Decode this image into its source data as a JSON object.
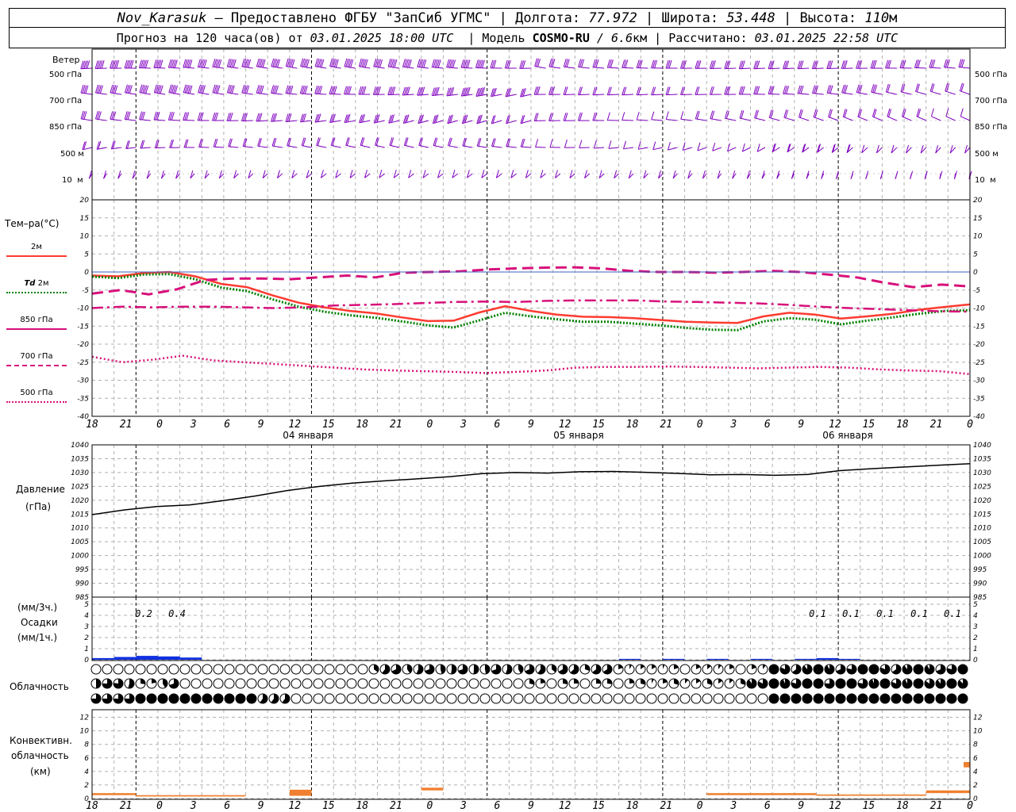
{
  "header": {
    "station": "Nov_Karasuk",
    "provider": "– Предоставлено ФГБУ \"ЗапСиб УГМС\" |",
    "lon_label": "Долгота:",
    "lon_value": "77.972",
    "lat_label": "| Широта:",
    "lat_value": "53.448",
    "alt_label": "| Высота:",
    "alt_value": "110",
    "alt_unit": "м"
  },
  "subheader": {
    "forecast_label": "Прогноз на 120 часа(ов) от",
    "forecast_time": "03.01.2025 18:00 UTC",
    "model_label": "| Модель",
    "model_name": "COSMO-RU",
    "model_res": "/ 6.6",
    "model_res_unit": "км",
    "calc_label": "| Рассчитано:",
    "calc_time": "03.01.2025 22:58 UTC"
  },
  "labels": {
    "wind": "Ветер",
    "wind_levels": [
      "500 гПа",
      "700 гПа",
      "850 гПа",
      "500 м",
      "10  м"
    ],
    "temp": "Тем–ра(°C)",
    "pressure": "Давление",
    "pressure_unit": "(гПа)",
    "precip_3h": "(мм/3ч.)",
    "precip": "Осадки",
    "precip_1h": "(мм/1ч.)",
    "cloud": "Облачность",
    "conv1": "Конвективн.",
    "conv2": "облачность",
    "conv3": "(км)"
  },
  "legend": {
    "t2m": {
      "label": "2м",
      "color": "#ff3b30"
    },
    "td2m": {
      "label_prefix": "Td",
      "label": "2м",
      "color": "#008000"
    },
    "t850": {
      "label": "850 гПа",
      "color": "#d8107a"
    },
    "t700": {
      "label": "700 гПа",
      "color": "#d8107a"
    },
    "t500": {
      "label": "500 гПа",
      "color": "#d8107a"
    }
  },
  "chart_data": [
    {
      "type": "wind_barbs",
      "levels": [
        "500 гПа",
        "700 гПа",
        "850 гПа",
        "500 м",
        "10  м"
      ],
      "color": "#8000c0"
    },
    {
      "type": "line",
      "title": "Тем–ра(°C)",
      "x_ticks": [
        "18",
        "21",
        "0",
        "3",
        "6",
        "9",
        "12",
        "15",
        "18",
        "21",
        "0",
        "3",
        "6",
        "9",
        "12",
        "15",
        "18",
        "21",
        "0",
        "3",
        "6",
        "9",
        "12",
        "15",
        "18",
        "21",
        "0"
      ],
      "day_labels": [
        "04 января",
        "05 января",
        "06 января"
      ],
      "ylim": [
        -40,
        20
      ],
      "y_ticks": [
        20,
        15,
        10,
        5,
        0,
        -5,
        -10,
        -15,
        -20,
        -25,
        -30,
        -35,
        -40
      ],
      "hours": [
        0,
        3,
        6,
        9,
        12,
        15,
        18,
        21,
        24,
        27,
        30,
        33,
        36,
        39,
        42,
        45,
        48,
        51,
        54,
        57,
        60,
        63,
        66,
        69,
        72,
        75,
        78,
        81,
        84,
        87,
        90,
        93,
        96,
        99,
        102,
        105,
        108,
        111,
        114,
        117,
        120
      ],
      "series": [
        {
          "name": "2м",
          "color": "#ff3b30",
          "values": [
            -1,
            -1.2,
            -0.3,
            0,
            -1.2,
            -3.3,
            -4.2,
            -6.5,
            -8.5,
            -9.8,
            -10.8,
            -11.5,
            -12.6,
            -13.6,
            -13.5,
            -11.2,
            -9.5,
            -10.8,
            -11.8,
            -12.4,
            -12.5,
            -12.8,
            -13.3,
            -13.8,
            -14,
            -14.1,
            -12.3,
            -11.3,
            -11.8,
            -12.9,
            -12.3,
            -11.6,
            -10.5,
            -9.7,
            -9
          ]
        },
        {
          "name": "Td 2м",
          "color": "#008000",
          "values": [
            -1.3,
            -1.7,
            -0.7,
            -0.6,
            -2,
            -4.3,
            -5.3,
            -7.6,
            -9.6,
            -11,
            -12,
            -12.7,
            -13.7,
            -14.8,
            -15.4,
            -13.4,
            -11.3,
            -12.3,
            -13.1,
            -13.8,
            -13.8,
            -14.3,
            -14.8,
            -15.5,
            -16,
            -16.1,
            -13.7,
            -12.8,
            -13.2,
            -14.5,
            -13.5,
            -12.6,
            -11.6,
            -10.8,
            -10.6
          ]
        },
        {
          "name": "850 гПа",
          "color": "#d8107a",
          "values": [
            -6,
            -5,
            -6.2,
            -4.8,
            -2.2,
            -1.8,
            -1.8,
            -2,
            -1.5,
            -1,
            -1.5,
            -0.2,
            0,
            0.2,
            0.7,
            1,
            1.2,
            1.3,
            1,
            0.3,
            0,
            0,
            -0.2,
            0,
            0.3,
            0,
            -0.7,
            -1.5,
            -3,
            -4.2,
            -3.5,
            -4
          ]
        },
        {
          "name": "700 гПа",
          "color": "#d8107a",
          "values": [
            -10,
            -9.6,
            -9.8,
            -9.6,
            -9.6,
            -9.8,
            -10,
            -9.8,
            -9.3,
            -9.1,
            -8.9,
            -8.6,
            -8.3,
            -8.2,
            -8.3,
            -8,
            -7.9,
            -7.9,
            -7.9,
            -8.2,
            -8.3,
            -8.5,
            -8.7,
            -9.1,
            -9.6,
            -10,
            -10.3,
            -10.6,
            -10.9,
            -11
          ]
        },
        {
          "name": "500 гПа",
          "color": "#d8107a",
          "values": [
            -23.5,
            -25,
            -24.3,
            -23.2,
            -24.5,
            -25,
            -25.5,
            -26,
            -26.5,
            -27,
            -27.3,
            -27.5,
            -27.7,
            -28,
            -27.7,
            -27.3,
            -26.5,
            -26.3,
            -26.3,
            -26.2,
            -26.3,
            -26.5,
            -26.7,
            -26.5,
            -26.3,
            -26.5,
            -27,
            -27.3,
            -27.5,
            -28.3
          ]
        }
      ]
    },
    {
      "type": "line",
      "title": "Давление (гПа)",
      "ylim": [
        985,
        1040
      ],
      "y_ticks": [
        1040,
        1035,
        1030,
        1025,
        1020,
        1015,
        1010,
        1005,
        1000,
        995,
        990,
        985
      ],
      "series": [
        {
          "name": "Давление",
          "color": "#000000",
          "values": [
            1014.8,
            1016.5,
            1017.7,
            1018.3,
            1019.8,
            1021.5,
            1023.5,
            1025,
            1026.2,
            1027,
            1027.7,
            1028.5,
            1029.6,
            1030,
            1029.8,
            1030.3,
            1030.4,
            1030.1,
            1029.7,
            1029.2,
            1029.3,
            1029,
            1029.3,
            1030.7,
            1031.4,
            1032,
            1032.6,
            1033.2
          ]
        }
      ]
    },
    {
      "type": "bar",
      "title": "Осадки",
      "ylim": [
        0,
        5
      ],
      "y_ticks": [
        5,
        4,
        3,
        2,
        1,
        0
      ],
      "annotations": [
        "0.2",
        "0.4",
        "0.1",
        "0.1",
        "0.1",
        "0.1",
        "0.1"
      ],
      "color": "#1030e0"
    },
    {
      "type": "cloud_symbols",
      "title": "Облачность",
      "rows": 3
    },
    {
      "type": "bar",
      "title": "Конвективн. облачность (км)",
      "ylim": [
        0,
        13
      ],
      "y_ticks": [
        12,
        10,
        8,
        6,
        4,
        2,
        0
      ],
      "color": "#f08030"
    }
  ]
}
